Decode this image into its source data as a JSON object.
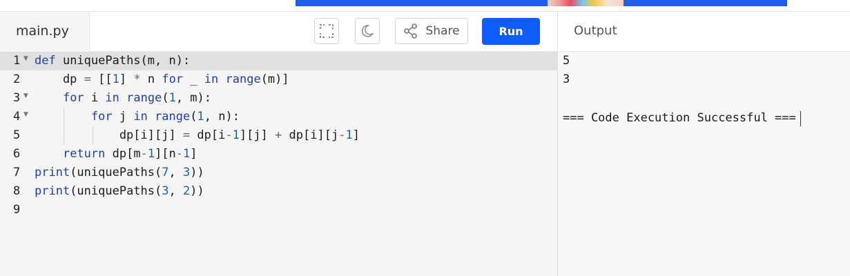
{
  "editor": {
    "filename": "main.py",
    "toolbar": {
      "fullscreen_icon": "fullscreen-icon",
      "theme_icon": "moon-icon",
      "share_label": "Share",
      "run_label": "Run",
      "run_color": "#0e5dfb"
    },
    "line_numbers": [
      "1",
      "2",
      "3",
      "4",
      "5",
      "6",
      "7",
      "8",
      "9"
    ],
    "active_line": "1"
  },
  "output": {
    "title": "Output",
    "lines": [
      "5",
      "3",
      "",
      "=== Code Execution Successful ==="
    ]
  }
}
